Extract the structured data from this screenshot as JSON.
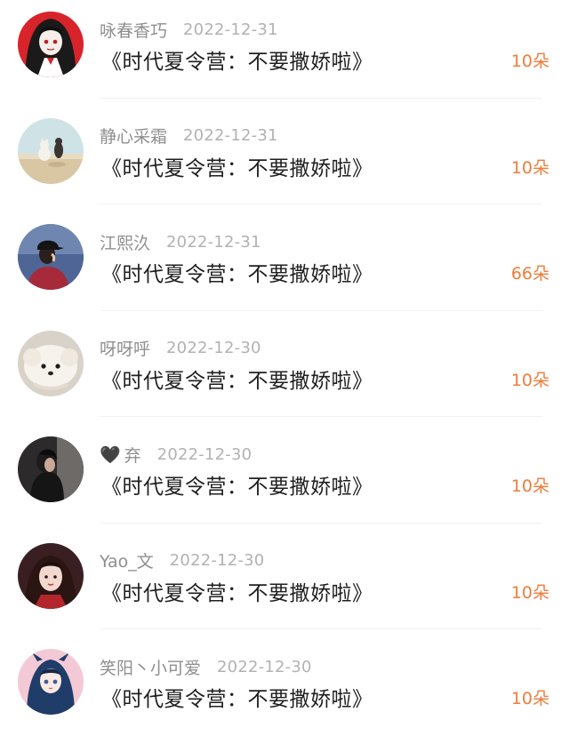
{
  "gift_list": {
    "entries": [
      {
        "user": "咏春香巧",
        "date": "2022-12-31",
        "title": "《时代夏令营：不要撒娇啦》",
        "gift": "10朵",
        "avatar_icon": "anime-girl-avatar"
      },
      {
        "user": "静心采霜",
        "date": "2022-12-31",
        "title": "《时代夏令营：不要撒娇啦》",
        "gift": "10朵",
        "avatar_icon": "cats-photo-avatar"
      },
      {
        "user": "江熙汣",
        "date": "2022-12-31",
        "title": "《时代夏令营：不要撒娇啦》",
        "gift": "66朵",
        "avatar_icon": "person-cap-sea-avatar"
      },
      {
        "user": "呀呀呼",
        "date": "2022-12-30",
        "title": "《时代夏令营：不要撒娇啦》",
        "gift": "10朵",
        "avatar_icon": "white-dog-avatar"
      },
      {
        "user": "弃",
        "user_prefix": "🖤",
        "date": "2022-12-30",
        "title": "《时代夏令营：不要撒娇啦》",
        "gift": "10朵",
        "avatar_icon": "dark-portrait-avatar"
      },
      {
        "user": "Yao_文",
        "date": "2022-12-30",
        "title": "《时代夏令营：不要撒娇啦》",
        "gift": "10朵",
        "avatar_icon": "girl-portrait-avatar"
      },
      {
        "user": "笑阳丶小可爱",
        "date": "2022-12-30",
        "title": "《时代夏令营：不要撒娇啦》",
        "gift": "10朵",
        "avatar_icon": "anime-hood-avatar"
      }
    ]
  },
  "colors": {
    "gift_accent": "#f07c3a",
    "meta_text": "#9a9a9a",
    "title_text": "#1f1f1f",
    "divider": "#f0f0f0"
  }
}
